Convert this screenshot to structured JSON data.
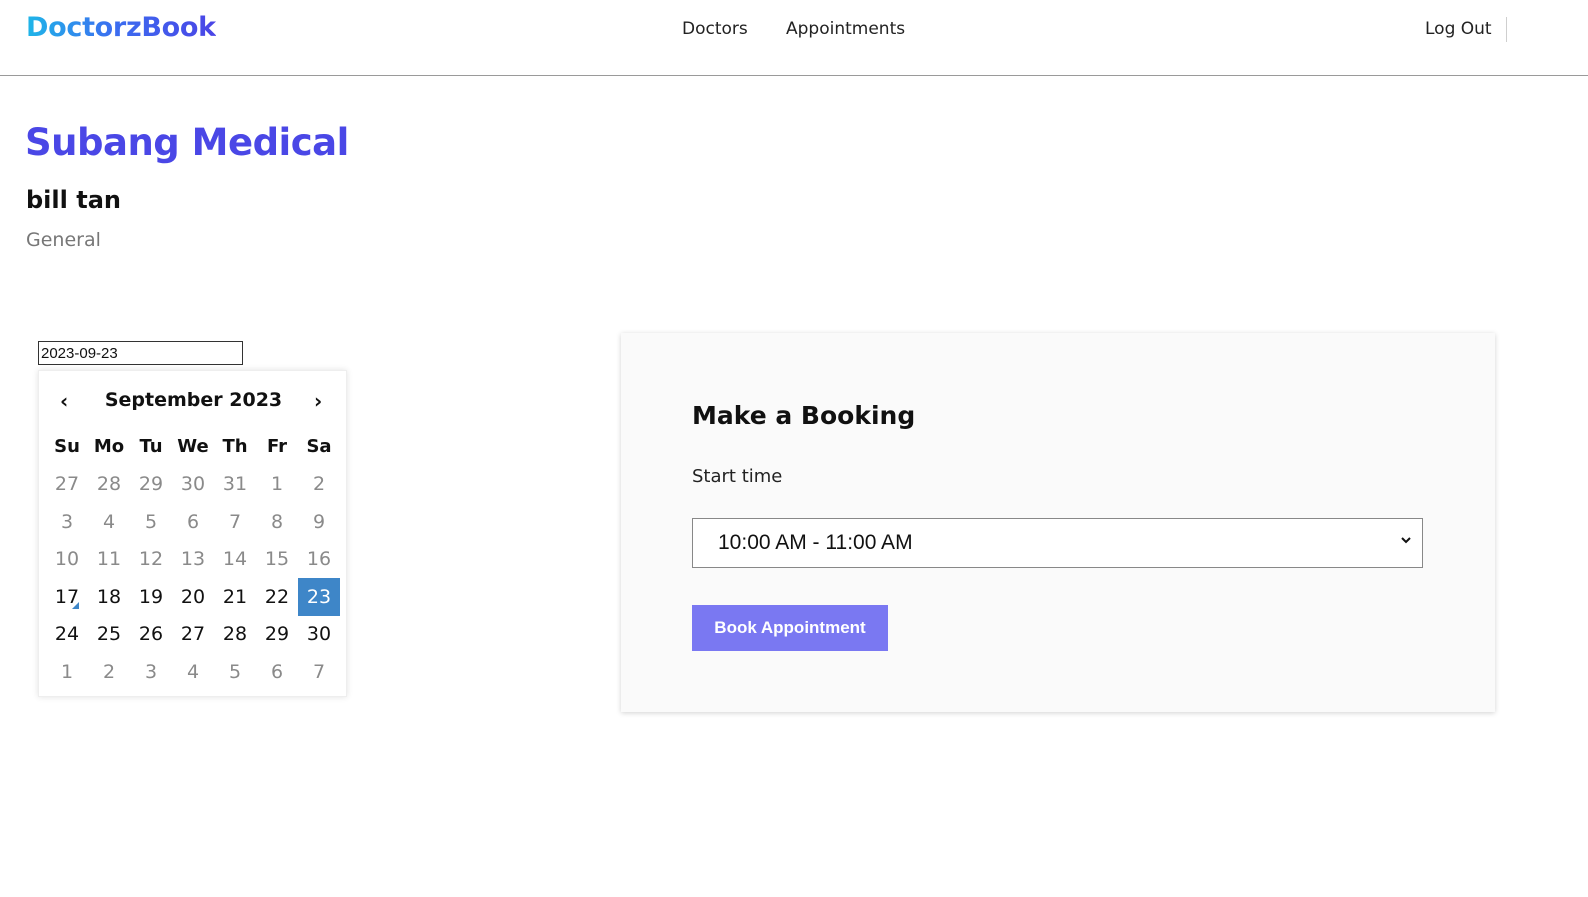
{
  "header": {
    "logo": "DoctorzBook",
    "nav": {
      "doctors": "Doctors",
      "appointments": "Appointments",
      "logout": "Log Out"
    }
  },
  "clinic": {
    "name": "Subang Medical",
    "doctor": "bill tan",
    "specialty": "General"
  },
  "date_input": {
    "value": "2023-09-23"
  },
  "calendar": {
    "title": "September 2023",
    "prev": "‹",
    "next": "›",
    "weekdays": [
      "Su",
      "Mo",
      "Tu",
      "We",
      "Th",
      "Fr",
      "Sa"
    ],
    "weeks": [
      [
        {
          "d": "27",
          "m": true
        },
        {
          "d": "28",
          "m": true
        },
        {
          "d": "29",
          "m": true
        },
        {
          "d": "30",
          "m": true
        },
        {
          "d": "31",
          "m": true
        },
        {
          "d": "1",
          "m": true
        },
        {
          "d": "2",
          "m": true
        }
      ],
      [
        {
          "d": "3",
          "m": true
        },
        {
          "d": "4",
          "m": true
        },
        {
          "d": "5",
          "m": true
        },
        {
          "d": "6",
          "m": true
        },
        {
          "d": "7",
          "m": true
        },
        {
          "d": "8",
          "m": true
        },
        {
          "d": "9",
          "m": true
        }
      ],
      [
        {
          "d": "10",
          "m": true
        },
        {
          "d": "11",
          "m": true
        },
        {
          "d": "12",
          "m": true
        },
        {
          "d": "13",
          "m": true
        },
        {
          "d": "14",
          "m": true
        },
        {
          "d": "15",
          "m": true
        },
        {
          "d": "16",
          "m": true
        }
      ],
      [
        {
          "d": "17",
          "today": true
        },
        {
          "d": "18"
        },
        {
          "d": "19"
        },
        {
          "d": "20"
        },
        {
          "d": "21"
        },
        {
          "d": "22"
        },
        {
          "d": "23",
          "selected": true
        }
      ],
      [
        {
          "d": "24"
        },
        {
          "d": "25"
        },
        {
          "d": "26"
        },
        {
          "d": "27"
        },
        {
          "d": "28"
        },
        {
          "d": "29"
        },
        {
          "d": "30"
        }
      ],
      [
        {
          "d": "1",
          "m": true
        },
        {
          "d": "2",
          "m": true
        },
        {
          "d": "3",
          "m": true
        },
        {
          "d": "4",
          "m": true
        },
        {
          "d": "5",
          "m": true
        },
        {
          "d": "6",
          "m": true
        },
        {
          "d": "7",
          "m": true
        }
      ]
    ]
  },
  "booking": {
    "title": "Make a Booking",
    "start_label": "Start time",
    "selected_time": "10:00 AM - 11:00 AM",
    "button": "Book Appointment"
  },
  "colors": {
    "accent": "#4a47e6",
    "button": "#7a78f2",
    "selected_day": "#3e86c8"
  }
}
